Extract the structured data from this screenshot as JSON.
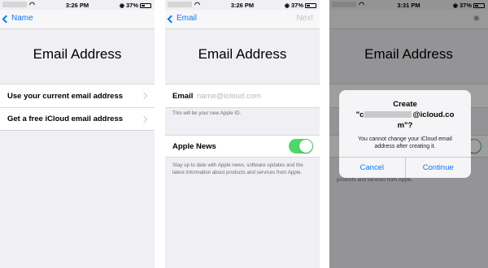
{
  "screen1": {
    "status": {
      "time": "3:26 PM",
      "battery": "37%"
    },
    "nav": {
      "back_label": "Name"
    },
    "title": "Email Address",
    "options": [
      {
        "label": "Use your current email address"
      },
      {
        "label": "Get a free iCloud email address"
      }
    ]
  },
  "screen2": {
    "status": {
      "time": "3:26 PM",
      "battery": "37%"
    },
    "nav": {
      "back_label": "Email",
      "next_label": "Next"
    },
    "title": "Email Address",
    "email_label": "Email",
    "email_placeholder": "name@icloud.com",
    "email_footnote": "This will be your new Apple ID.",
    "news_label": "Apple News",
    "news_enabled": true,
    "news_footnote": "Stay up to date with Apple news, software updates and the latest information about products and services from Apple."
  },
  "screen3": {
    "status": {
      "time": "3:31 PM",
      "battery": "37%"
    },
    "title": "Email Address",
    "alert": {
      "title_line1": "Create",
      "title_prefix": "\"c",
      "title_suffix": "@icloud.co",
      "title_line3": "m\"?",
      "message": "You cannot change your iCloud email address after creating it.",
      "cancel_label": "Cancel",
      "continue_label": "Continue"
    },
    "bg_footnote": "products and services from Apple."
  },
  "colors": {
    "accent": "#0a7aff",
    "toggle_on": "#4cd964",
    "background": "#efeff4"
  }
}
